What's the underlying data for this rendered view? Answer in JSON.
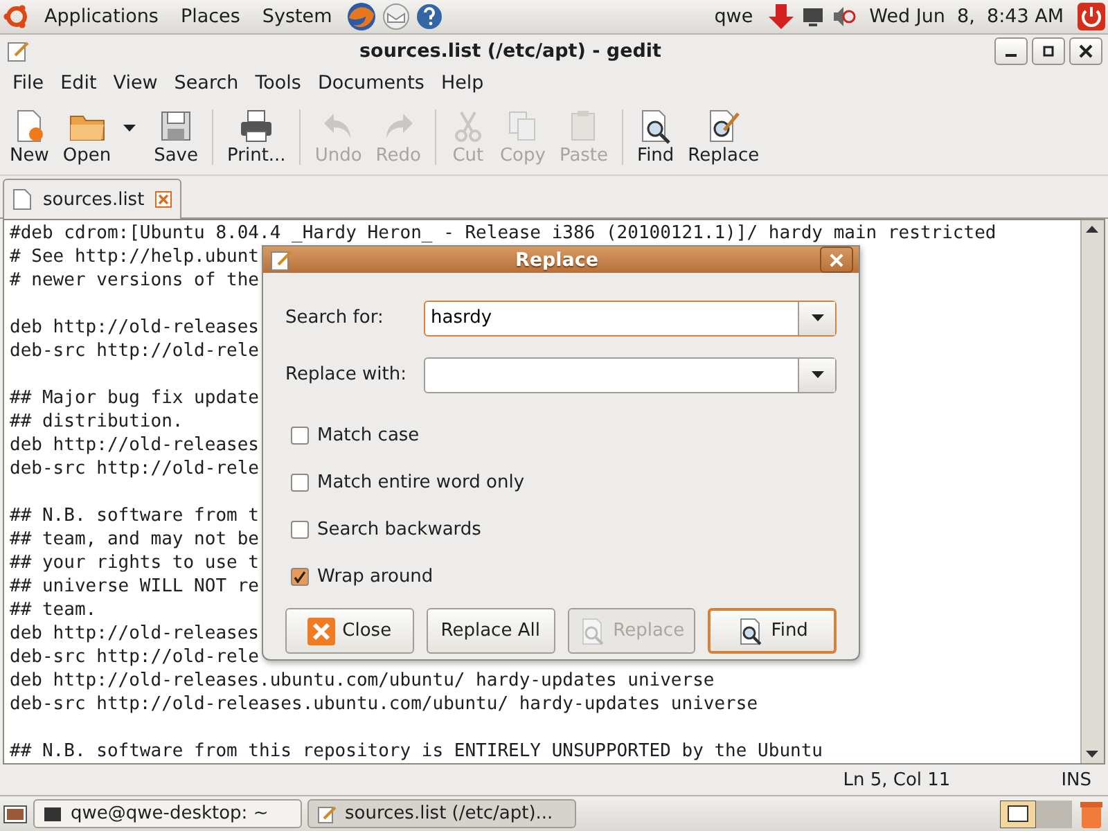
{
  "top_panel": {
    "menus": [
      "Applications",
      "Places",
      "System"
    ],
    "user": "qwe",
    "clock": "Wed Jun  8,  8:43 AM"
  },
  "window": {
    "title": "sources.list (/etc/apt) - gedit"
  },
  "menubar": [
    "File",
    "Edit",
    "View",
    "Search",
    "Tools",
    "Documents",
    "Help"
  ],
  "toolbar": [
    {
      "kind": "button",
      "label": "New",
      "disabled": false
    },
    {
      "kind": "button",
      "label": "Open",
      "disabled": false,
      "has_menu": true
    },
    {
      "kind": "button",
      "label": "Save",
      "disabled": false
    },
    {
      "kind": "separator"
    },
    {
      "kind": "button",
      "label": "Print...",
      "disabled": false
    },
    {
      "kind": "separator"
    },
    {
      "kind": "button",
      "label": "Undo",
      "disabled": true
    },
    {
      "kind": "button",
      "label": "Redo",
      "disabled": true
    },
    {
      "kind": "separator"
    },
    {
      "kind": "button",
      "label": "Cut",
      "disabled": true
    },
    {
      "kind": "button",
      "label": "Copy",
      "disabled": true
    },
    {
      "kind": "button",
      "label": "Paste",
      "disabled": true
    },
    {
      "kind": "separator"
    },
    {
      "kind": "button",
      "label": "Find",
      "disabled": false
    },
    {
      "kind": "button",
      "label": "Replace",
      "disabled": false
    }
  ],
  "tabs": [
    {
      "label": "sources.list",
      "selected": true
    }
  ],
  "editor_lines": [
    {
      "kind": "text",
      "text": "#deb cdrom:[Ubuntu 8.04.4 _Hardy Heron_ - Release i386 (20100121.1)]/ hardy main restricted"
    },
    {
      "kind": "text",
      "text": "# See http://help.ubunt"
    },
    {
      "kind": "text",
      "text": "# newer versions of the"
    },
    {
      "kind": "blank"
    },
    {
      "kind": "text",
      "text": "deb http://old-releases"
    },
    {
      "kind": "text",
      "text": "deb-src http://old-rele"
    },
    {
      "kind": "blank"
    },
    {
      "kind": "text",
      "text": "## Major bug fix update"
    },
    {
      "kind": "text",
      "text": "## distribution."
    },
    {
      "kind": "text",
      "text": "deb http://old-releases"
    },
    {
      "kind": "text",
      "text": "deb-src http://old-rele"
    },
    {
      "kind": "blank"
    },
    {
      "kind": "text",
      "text": "## N.B. software from t"
    },
    {
      "kind": "text",
      "text": "## team, and may not be"
    },
    {
      "kind": "text",
      "text": "## your rights to use t"
    },
    {
      "kind": "text",
      "text": "## universe WILL NOT re"
    },
    {
      "kind": "text",
      "text": "## team."
    },
    {
      "kind": "text",
      "text": "deb http://old-releases"
    },
    {
      "kind": "text",
      "text": "deb-src http://old-rele"
    },
    {
      "kind": "text",
      "text": "deb http://old-releases.ubuntu.com/ubuntu/ hardy-updates universe"
    },
    {
      "kind": "text",
      "text": "deb-src http://old-releases.ubuntu.com/ubuntu/ hardy-updates universe"
    },
    {
      "kind": "blank"
    },
    {
      "kind": "text",
      "text": "## N.B. software from this repository is ENTIRELY UNSUPPORTED by the Ubuntu"
    }
  ],
  "status_bar": {
    "position": "Ln 5, Col 11",
    "mode": "INS"
  },
  "dialog": {
    "title": "Replace",
    "fields": [
      {
        "label": "Search for:",
        "value": "hasrdy",
        "focused": true
      },
      {
        "label": "Replace with:",
        "focused": false
      }
    ],
    "options": [
      {
        "label": "Match case",
        "checked": false
      },
      {
        "label": "Match entire word only",
        "checked": false
      },
      {
        "label": "Search backwards",
        "checked": false
      },
      {
        "label": "Wrap around",
        "checked": true
      }
    ],
    "buttons": [
      {
        "label": "Close",
        "disabled": false,
        "default": false
      },
      {
        "label": "Replace All",
        "disabled": false,
        "default": false
      },
      {
        "label": "Replace",
        "disabled": true,
        "default": false
      },
      {
        "label": "Find",
        "disabled": false,
        "default": true
      }
    ]
  },
  "taskbar": [
    {
      "label": "qwe@qwe-desktop: ~",
      "selected": false
    },
    {
      "label": "sources.list (/etc/apt)...",
      "selected": true
    }
  ]
}
